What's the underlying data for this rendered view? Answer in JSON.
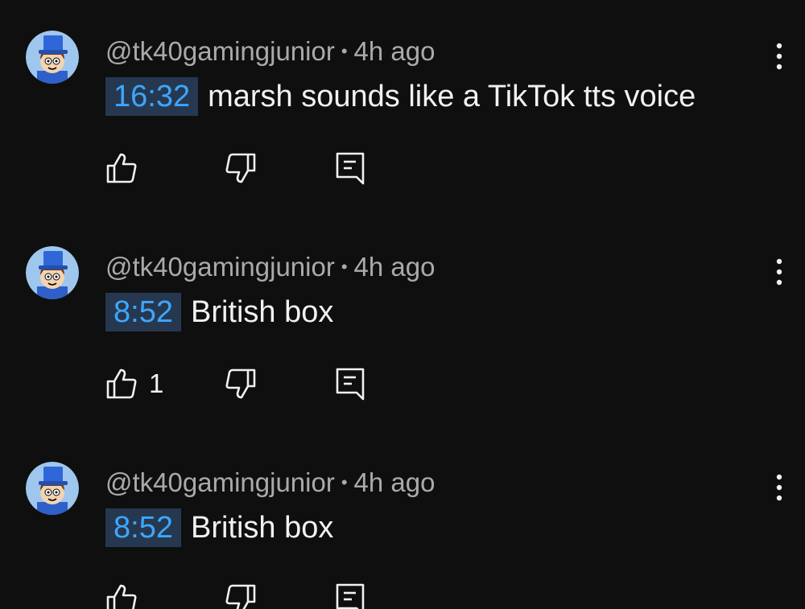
{
  "comments": [
    {
      "author": "@tk40gamingjunior",
      "separator": "•",
      "age": "4h ago",
      "timestamp": "16:32",
      "text": "marsh sounds like a TikTok tts voice",
      "likes": ""
    },
    {
      "author": "@tk40gamingjunior",
      "separator": "•",
      "age": "4h ago",
      "timestamp": "8:52",
      "text": "British box",
      "likes": "1"
    },
    {
      "author": "@tk40gamingjunior",
      "separator": "•",
      "age": "4h ago",
      "timestamp": "8:52",
      "text": "British box",
      "likes": ""
    }
  ],
  "icons": {
    "like": "thumbs-up-icon",
    "dislike": "thumbs-down-icon",
    "reply": "reply-comment-icon",
    "more": "more-vertical-icon",
    "avatar": "cartoon-avatar-blue-top-hat"
  },
  "colors": {
    "background": "#0f0f0f",
    "timestamp_link": "#3ea6ff",
    "timestamp_bg": "#263850",
    "meta_text": "#aaaaaa",
    "body_text": "#f1f1f1"
  }
}
